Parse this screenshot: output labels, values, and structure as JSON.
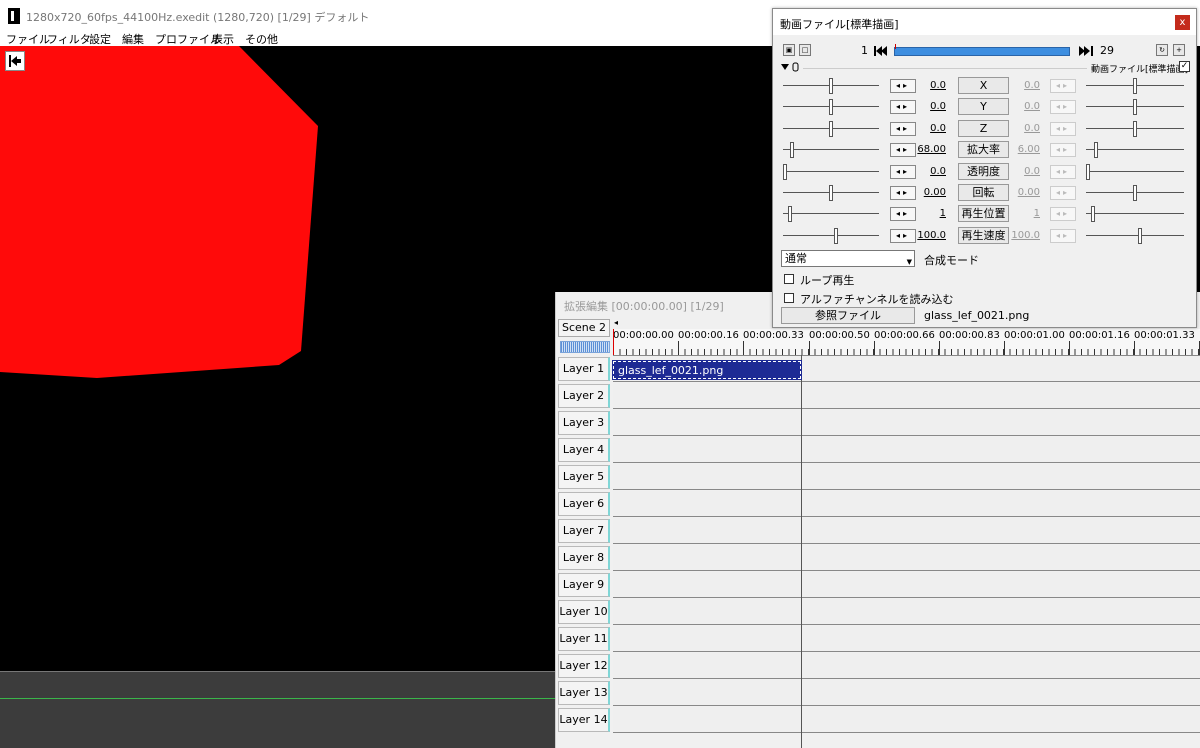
{
  "main": {
    "title": "1280x720_60fps_44100Hz.exedit (1280,720)  [1/29]  デフォルト",
    "menu": [
      "ファイル",
      "フィルタ",
      "設定",
      "編集",
      "プロファイル",
      "表示",
      "その他"
    ]
  },
  "preview": {
    "shape_color": "#ff0a0a",
    "background": "#000000"
  },
  "timeline": {
    "title": "拡張編集 [00:00:00.00] [1/29]",
    "scene": "Scene 2",
    "times": [
      "00:00:00.00",
      "00:00:00.16",
      "00:00:00.33",
      "00:00:00.50",
      "00:00:00.66",
      "00:00:00.83",
      "00:00:01.00",
      "00:00:01.16",
      "00:00:01.33"
    ],
    "layers": [
      "Layer 1",
      "Layer 2",
      "Layer 3",
      "Layer 4",
      "Layer 5",
      "Layer 6",
      "Layer 7",
      "Layer 8",
      "Layer 9",
      "Layer 10",
      "Layer 11",
      "Layer 12",
      "Layer 13",
      "Layer 14"
    ],
    "clip": {
      "name": "glass_lef_0021.png",
      "color": "#1e2a94"
    }
  },
  "dialog": {
    "title": "動画ファイル[標準描画]",
    "close": "x",
    "frame_start": "1",
    "frame_end": "29",
    "object_name": "動画ファイル[標準描画]",
    "checked": "✓",
    "params": [
      {
        "label": "X",
        "value": "0.0",
        "value2": "0.0",
        "pos": 0.5,
        "pos2": 0.5
      },
      {
        "label": "Y",
        "value": "0.0",
        "value2": "0.0",
        "pos": 0.5,
        "pos2": 0.5
      },
      {
        "label": "Z",
        "value": "0.0",
        "value2": "0.0",
        "pos": 0.5,
        "pos2": 0.5
      },
      {
        "label": "拡大率",
        "value": "68.00",
        "value2": "6.00",
        "pos": 0.08,
        "pos2": 0.08
      },
      {
        "label": "透明度",
        "value": "0.0",
        "value2": "0.0",
        "pos": 0.0,
        "pos2": 0.0
      },
      {
        "label": "回転",
        "value": "0.00",
        "value2": "0.00",
        "pos": 0.5,
        "pos2": 0.5
      },
      {
        "label": "再生位置",
        "value": "1",
        "value2": "1",
        "pos": 0.05,
        "pos2": 0.05
      },
      {
        "label": "再生速度",
        "value": "100.0",
        "value2": "100.0",
        "pos": 0.55,
        "pos2": 0.55
      }
    ],
    "blend_mode": "通常",
    "blend_label": "合成モード",
    "loop_label": "ループ再生",
    "alpha_label": "アルファチャンネルを読み込む",
    "ref_button": "参照ファイル",
    "ref_file": "glass_lef_0021.png"
  }
}
